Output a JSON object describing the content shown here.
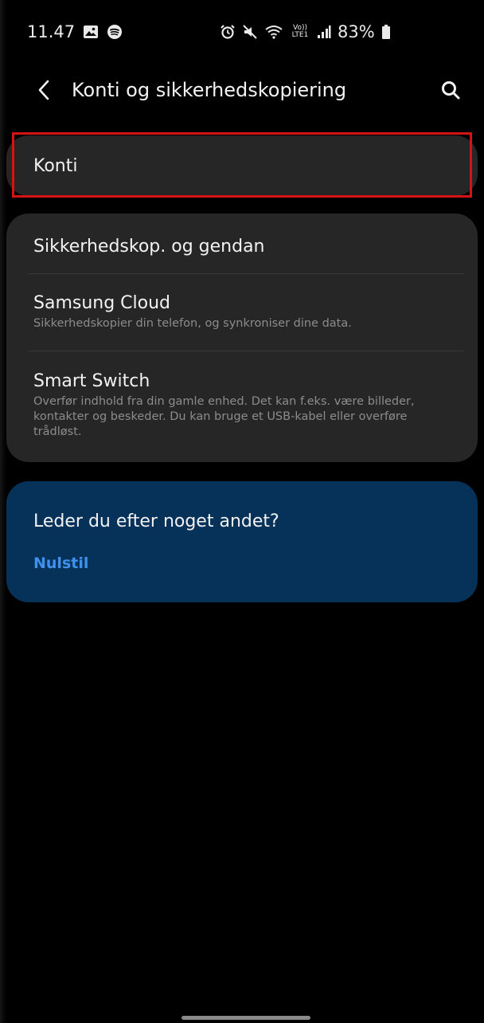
{
  "status_bar": {
    "time": "11.47",
    "icons_left": [
      "gallery-icon",
      "spotify-icon"
    ],
    "icons_right": [
      "alarm-icon",
      "mute-icon",
      "wifi-icon",
      "volte-icon",
      "signal-icon",
      "battery-icon"
    ],
    "volte_text": "Vo)) LTE1",
    "battery": "83%"
  },
  "header": {
    "title": "Konti og sikkerhedskopiering"
  },
  "accounts_card": {
    "label": "Konti",
    "highlight_color": "#d21414"
  },
  "backup_card": {
    "items": [
      {
        "title": "Sikkerhedskop. og gendan",
        "subtitle": ""
      },
      {
        "title": "Samsung Cloud",
        "subtitle": "Sikkerhedskopier din telefon, og synkroniser dine data."
      },
      {
        "title": "Smart Switch",
        "subtitle": "Overfør indhold fra din gamle enhed. Det kan f.eks. være billeder, kontakter og beskeder. Du kan bruge et USB-kabel eller overføre trådløst."
      }
    ]
  },
  "suggestion_card": {
    "title": "Leder du efter noget andet?",
    "link": "Nulstil",
    "link_color": "#3e91ef",
    "background_color": "#06325a"
  }
}
